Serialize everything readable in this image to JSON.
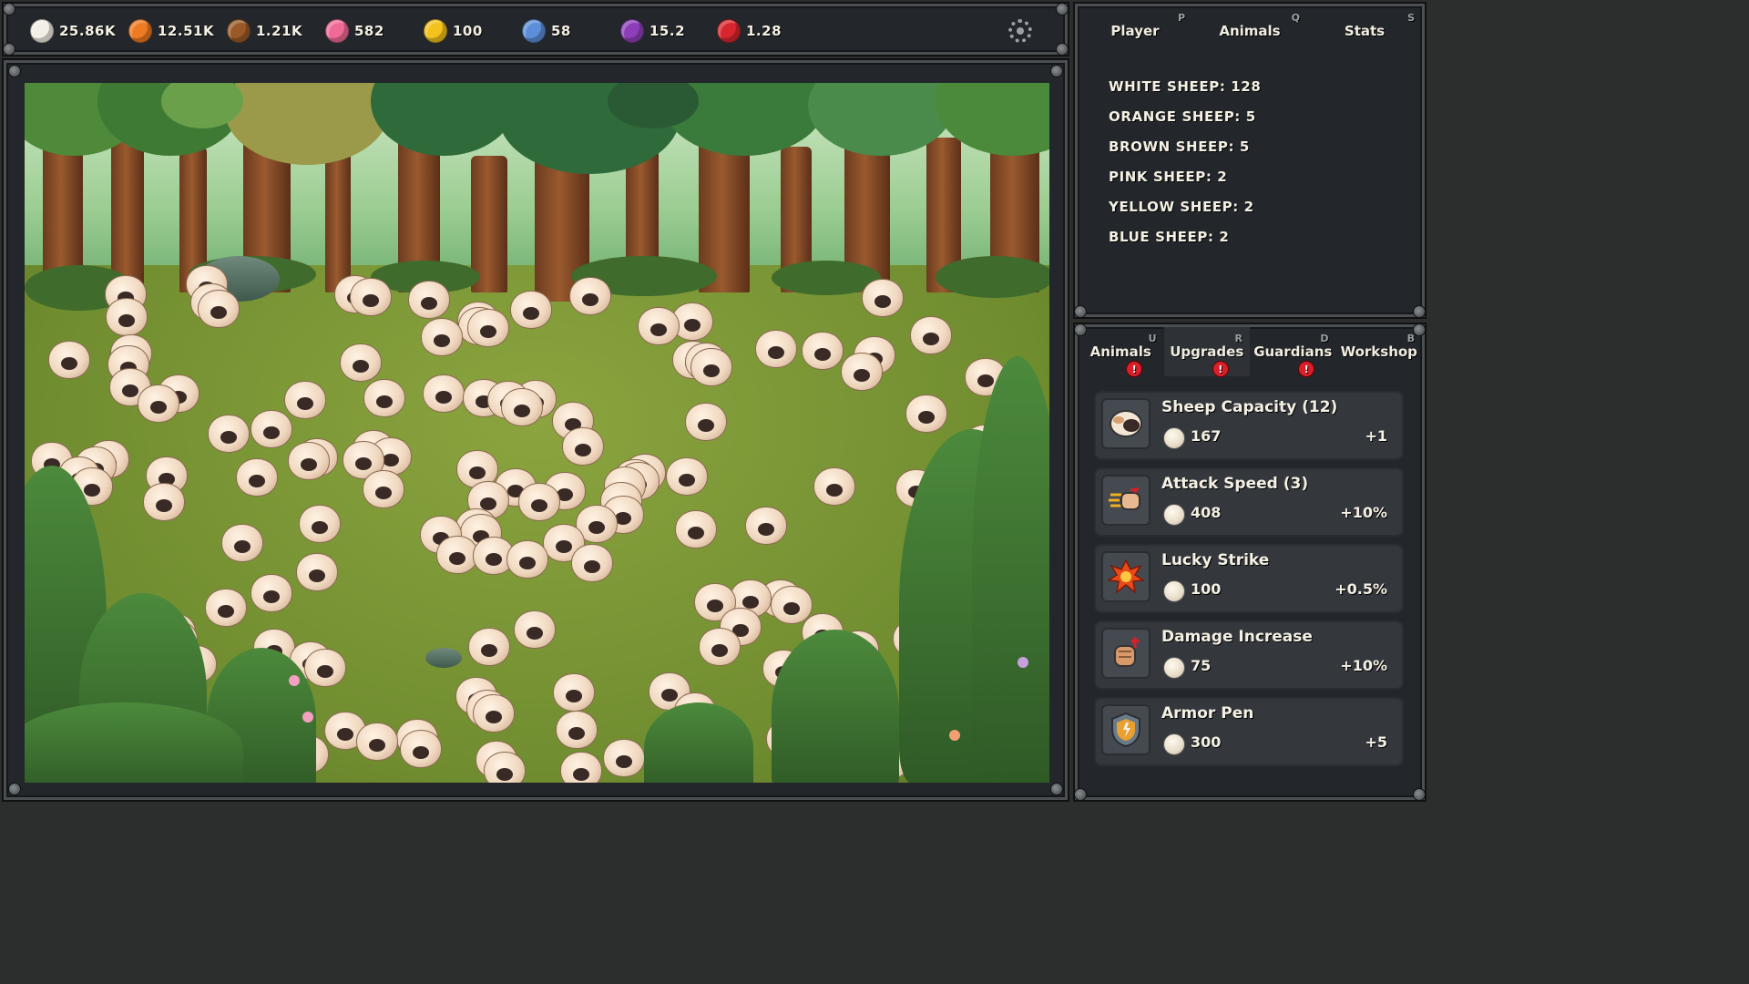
{
  "resources": [
    {
      "name": "white-wool",
      "value": "25.86K",
      "color": "#f2efe6"
    },
    {
      "name": "orange-wool",
      "value": "12.51K",
      "color": "#ee7a22"
    },
    {
      "name": "brown-wool",
      "value": "1.21K",
      "color": "#9a5a28"
    },
    {
      "name": "pink-wool",
      "value": "582",
      "color": "#f06a96"
    },
    {
      "name": "yellow-wool",
      "value": "100",
      "color": "#f3c21c"
    },
    {
      "name": "blue-wool",
      "value": "58",
      "color": "#5d8ed8"
    },
    {
      "name": "purple-wool",
      "value": "15.2",
      "color": "#8c3fb8"
    },
    {
      "name": "red-wool",
      "value": "1.28",
      "color": "#d8262e"
    }
  ],
  "settings_icon": "gear-icon",
  "stats_panel": {
    "tabs": [
      {
        "label": "Player",
        "hotkey": "P"
      },
      {
        "label": "Animals",
        "hotkey": "Q"
      },
      {
        "label": "Stats",
        "hotkey": "S"
      }
    ],
    "lines": [
      "WHITE SHEEP: 128",
      "ORANGE SHEEP: 5",
      "BROWN SHEEP: 5",
      "PINK SHEEP: 2",
      "YELLOW SHEEP: 2",
      "BLUE SHEEP: 2"
    ]
  },
  "shop_panel": {
    "tabs": [
      {
        "label": "Animals",
        "hotkey": "U",
        "alert": "!"
      },
      {
        "label": "Upgrades",
        "hotkey": "R",
        "alert": "!"
      },
      {
        "label": "Guardians",
        "hotkey": "D",
        "alert": "!"
      },
      {
        "label": "Workshop",
        "hotkey": "B",
        "alert": ""
      }
    ],
    "upgrades": [
      {
        "title": "Sheep Capacity (12)",
        "cost": "167",
        "bonus": "+1",
        "icon": "sheep-icon"
      },
      {
        "title": "Attack Speed (3)",
        "cost": "408",
        "bonus": "+10%",
        "icon": "fast-fist-icon"
      },
      {
        "title": "Lucky Strike",
        "cost": "100",
        "bonus": "+0.5%",
        "icon": "explosion-icon"
      },
      {
        "title": "Damage Increase",
        "cost": "75",
        "bonus": "+10%",
        "icon": "fist-up-icon"
      },
      {
        "title": "Armor Pen",
        "cost": "300",
        "bonus": "+5",
        "icon": "shield-icon"
      }
    ]
  }
}
